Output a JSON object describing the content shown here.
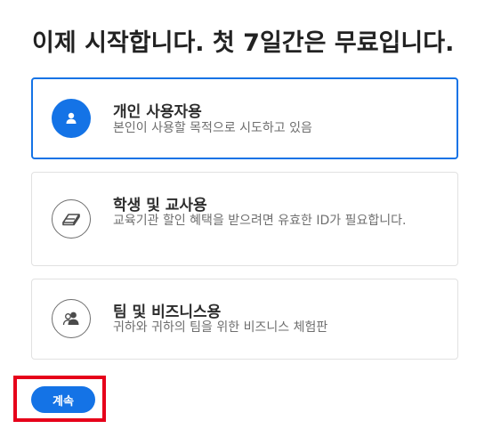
{
  "page": {
    "title": "이제 시작합니다. 첫 7일간은 무료입니다."
  },
  "options": [
    {
      "title": "개인 사용자용",
      "description": "본인이 사용할 목적으로 시도하고 있음",
      "icon": "person-icon",
      "selected": true
    },
    {
      "title": "학생 및 교사용",
      "description": "교육기관 할인 혜택을 받으려면 유효한 ID가 필요합니다.",
      "icon": "eraser-icon",
      "selected": false
    },
    {
      "title": "팀 및 비즈니스용",
      "description": "귀하와 귀하의 팀을 위한 비즈니스 체험판",
      "icon": "team-icon",
      "selected": false
    }
  ],
  "actions": {
    "continue_label": "계속"
  },
  "colors": {
    "accent": "#1473e6",
    "highlight": "#e6001a",
    "card_border": "#e1e1e1",
    "description_text": "#6e6e6e"
  }
}
